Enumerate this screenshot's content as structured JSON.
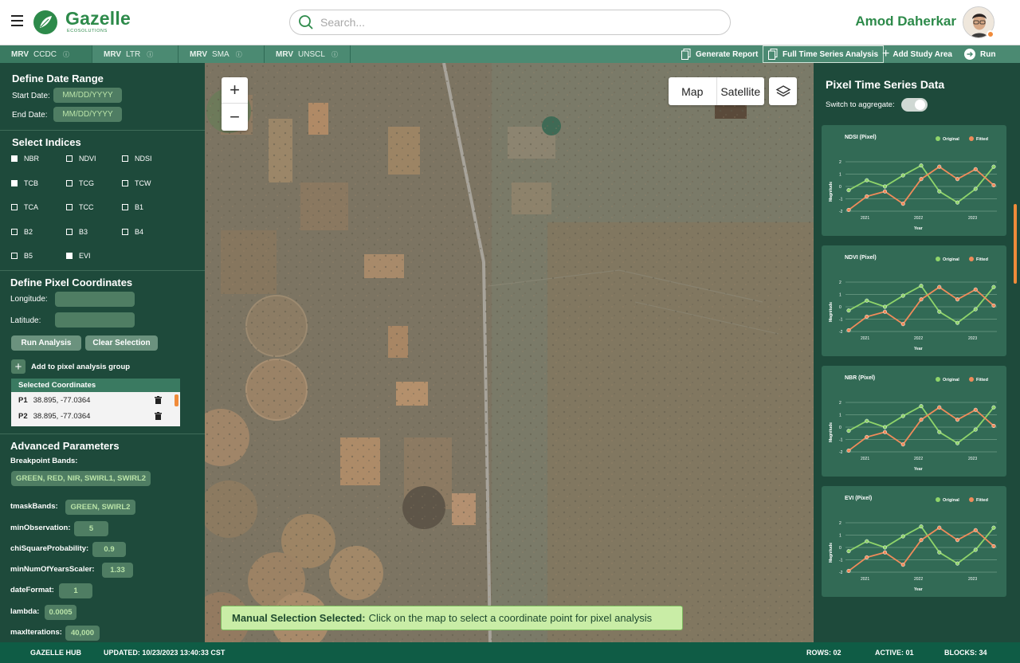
{
  "header": {
    "brand": "Gazelle",
    "brand_sub": "ECOSOLUTIONS",
    "search_placeholder": "Search...",
    "user_name": "Amod Daherkar"
  },
  "tabs": [
    {
      "prefix": "MRV",
      "label": "CCDC"
    },
    {
      "prefix": "MRV",
      "label": "LTR"
    },
    {
      "prefix": "MRV",
      "label": "SMA"
    },
    {
      "prefix": "MRV",
      "label": "UNSCL"
    }
  ],
  "actions": {
    "generate_report": "Generate Report",
    "full_time_series": "Full Time Series Analysis",
    "add_study_area": "Add Study Area",
    "run": "Run"
  },
  "left": {
    "date_title": "Define Date Range",
    "start_label": "Start Date:",
    "start_value": "MM/DD/YYYY",
    "end_label": "End Date:",
    "end_value": "MM/DD/YYYY",
    "indices_title": "Select Indices",
    "indices": [
      {
        "label": "NBR",
        "checked": true
      },
      {
        "label": "NDVI",
        "checked": false
      },
      {
        "label": "NDSI",
        "checked": false
      },
      {
        "label": "TCB",
        "checked": true
      },
      {
        "label": "TCG",
        "checked": false
      },
      {
        "label": "TCW",
        "checked": false
      },
      {
        "label": "TCA",
        "checked": false
      },
      {
        "label": "TCC",
        "checked": false
      },
      {
        "label": "B1",
        "checked": false
      },
      {
        "label": "B2",
        "checked": false
      },
      {
        "label": "B3",
        "checked": false
      },
      {
        "label": "B4",
        "checked": false
      },
      {
        "label": "B5",
        "checked": false
      },
      {
        "label": "EVI",
        "checked": true
      }
    ],
    "pixel_title": "Define Pixel Coordinates",
    "longitude_label": "Longitude:",
    "latitude_label": "Latitude:",
    "run_analysis": "Run Analysis",
    "clear_selection": "Clear Selection",
    "add_group": "Add to pixel analysis group",
    "selected_header": "Selected Coordinates",
    "selected": [
      {
        "id": "P1",
        "value": "38.895, -77.0364"
      },
      {
        "id": "P2",
        "value": "38.895, -77.0364"
      }
    ],
    "adv_title": "Advanced Parameters",
    "breakpoint_label": "Breakpoint Bands:",
    "breakpoint_value": "GREEN, RED, NIR, SWIRL1, SWIRL2",
    "params": [
      {
        "label": "tmaskBands:",
        "value": "GREEN, SWIRL2"
      },
      {
        "label": "minObservation:",
        "value": "5"
      },
      {
        "label": "chiSquareProbability:",
        "value": "0.9"
      },
      {
        "label": "minNumOfYearsScaler:",
        "value": "1.33"
      },
      {
        "label": "dateFormat:",
        "value": "1"
      },
      {
        "label": "lambda:",
        "value": "0.0005"
      },
      {
        "label": "maxIterations:",
        "value": "40,000"
      }
    ]
  },
  "map": {
    "zoom_in": "+",
    "zoom_out": "−",
    "map_type_map": "Map",
    "map_type_satellite": "Satellite",
    "banner_bold": "Manual Selection Selected:",
    "banner_text": "Click on the map to select a coordinate point for pixel analysis"
  },
  "right": {
    "title": "Pixel Time Series Data",
    "switch_label": "Switch to aggregate:",
    "legend_original": "Original",
    "legend_fitted": "Fitted",
    "y_label": "Magnitude",
    "x_label": "Year",
    "colors": {
      "original": "#8fd46a",
      "fitted": "#f08b5a"
    }
  },
  "chart_data": [
    {
      "type": "line",
      "title": "NDSI (Pixel)",
      "x": [
        "2020.7",
        "2020.9",
        "2021.2",
        "2021.5",
        "2021.8",
        "2022.0",
        "2022.3",
        "2022.6",
        "2022.9",
        "2023.2",
        "2023.4"
      ],
      "y_ticks": [
        -2,
        -1,
        0,
        1,
        2
      ],
      "x_ticks": [
        "2021",
        "2022",
        "2023"
      ],
      "xlabel": "Year",
      "ylabel": "Magnitude",
      "series": [
        {
          "name": "Original",
          "values": [
            -0.3,
            0.5,
            0,
            0.9,
            1.7,
            -0.4,
            -1.3,
            -0.2,
            1.6
          ]
        },
        {
          "name": "Fitted",
          "values": [
            -1.9,
            -0.8,
            -0.4,
            -1.4,
            0.6,
            1.6,
            0.6,
            1.4,
            0.1
          ]
        }
      ]
    },
    {
      "type": "line",
      "title": "NDVI (Pixel)",
      "x_ticks": [
        "2021",
        "2022",
        "2023"
      ],
      "y_ticks": [
        -2,
        -1,
        0,
        1,
        2
      ],
      "xlabel": "Year",
      "ylabel": "Magnitude",
      "series": [
        {
          "name": "Original",
          "values": [
            -0.3,
            0.5,
            0,
            0.9,
            1.7,
            -0.4,
            -1.3,
            -0.2,
            1.6
          ]
        },
        {
          "name": "Fitted",
          "values": [
            -1.9,
            -0.8,
            -0.4,
            -1.4,
            0.6,
            1.6,
            0.6,
            1.4,
            0.1
          ]
        }
      ]
    },
    {
      "type": "line",
      "title": "NBR (Pixel)",
      "x_ticks": [
        "2021",
        "2022",
        "2023"
      ],
      "y_ticks": [
        -2,
        -1,
        0,
        1,
        2
      ],
      "xlabel": "Year",
      "ylabel": "Magnitude",
      "series": [
        {
          "name": "Original",
          "values": [
            -0.3,
            0.5,
            0,
            0.9,
            1.7,
            -0.4,
            -1.3,
            -0.2,
            1.6
          ]
        },
        {
          "name": "Fitted",
          "values": [
            -1.9,
            -0.8,
            -0.4,
            -1.4,
            0.6,
            1.6,
            0.6,
            1.4,
            0.1
          ]
        }
      ]
    },
    {
      "type": "line",
      "title": "EVI (Pixel)",
      "x_ticks": [
        "2021",
        "2022",
        "2023"
      ],
      "y_ticks": [
        -2,
        -1,
        0,
        1,
        2
      ],
      "xlabel": "Year",
      "ylabel": "Magnitude",
      "series": [
        {
          "name": "Original",
          "values": [
            -0.3,
            0.5,
            0,
            0.9,
            1.7,
            -0.4,
            -1.3,
            -0.2,
            1.6
          ]
        },
        {
          "name": "Fitted",
          "values": [
            -1.9,
            -0.8,
            -0.4,
            -1.4,
            0.6,
            1.6,
            0.6,
            1.4,
            0.1
          ]
        }
      ]
    }
  ],
  "footer": {
    "hub": "GAZELLE HUB",
    "updated": "UPDATED: 10/23/2023 13:40:33 CST",
    "rows": "ROWS: 02",
    "active": "ACTIVE: 01",
    "blocks": "BLOCKS: 34"
  }
}
